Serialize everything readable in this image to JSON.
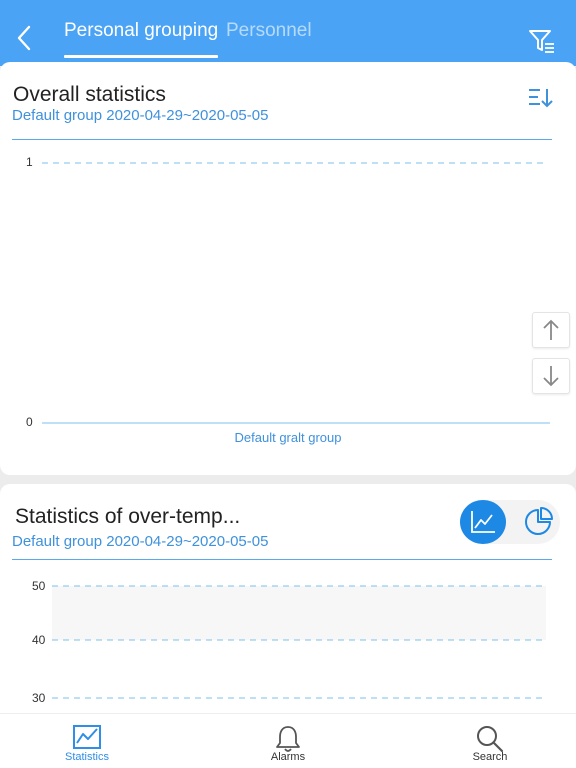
{
  "header": {
    "tabs": [
      {
        "label": "Personal grouping",
        "active": true
      },
      {
        "label": "Personnel",
        "active": false
      }
    ]
  },
  "overall": {
    "title": "Overall statistics",
    "subtitle": "Default group 2020-04-29~2020-05-05",
    "chart_data": {
      "type": "bar",
      "categories": [
        "Default gralt group"
      ],
      "values": [
        0
      ],
      "ylim": [
        0,
        1
      ],
      "y_ticks": [
        "0",
        "1"
      ],
      "grid": true
    }
  },
  "overtemp": {
    "title": "Statistics of over-temp...",
    "subtitle": "Default group 2020-04-29~2020-05-05",
    "chart_data": {
      "type": "line",
      "y_ticks": [
        "50",
        "40",
        "30"
      ],
      "grid": true
    }
  },
  "bottom_nav": [
    {
      "label": "Statistics",
      "icon": "line-chart-icon",
      "active": true
    },
    {
      "label": "Alarms",
      "icon": "bell-icon",
      "active": false
    },
    {
      "label": "Search",
      "icon": "search-icon",
      "active": false
    }
  ],
  "colors": {
    "primary": "#4aa3f5",
    "accent": "#1e88e5",
    "subtitle": "#3f91dc",
    "grid": "#7ec1ee"
  }
}
